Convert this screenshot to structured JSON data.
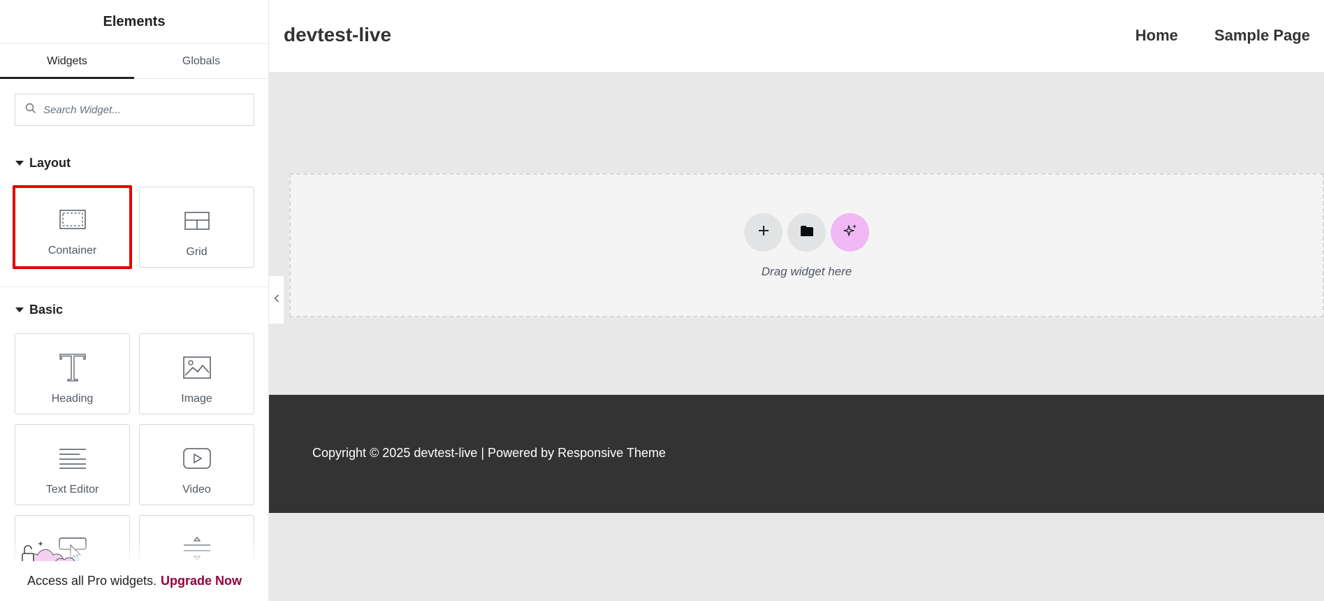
{
  "sidebar": {
    "title": "Elements",
    "tabs": [
      "Widgets",
      "Globals"
    ],
    "search_placeholder": "Search Widget...",
    "sections": {
      "layout": {
        "title": "Layout",
        "widgets": [
          "Container",
          "Grid"
        ]
      },
      "basic": {
        "title": "Basic",
        "widgets": [
          "Heading",
          "Image",
          "Text Editor",
          "Video"
        ]
      }
    },
    "promo": {
      "text": "Access all Pro widgets.",
      "link": "Upgrade Now"
    }
  },
  "site": {
    "title": "devtest-live",
    "nav": [
      "Home",
      "Sample Page"
    ]
  },
  "dropzone": {
    "text": "Drag widget here"
  },
  "footer": {
    "text": "Copyright © 2025 devtest-live | Powered by Responsive Theme"
  },
  "colors": {
    "highlight_border": "#e30000",
    "ai_button": "#f0b8f5",
    "upgrade_link": "#93003f",
    "footer_bg": "#333333"
  }
}
